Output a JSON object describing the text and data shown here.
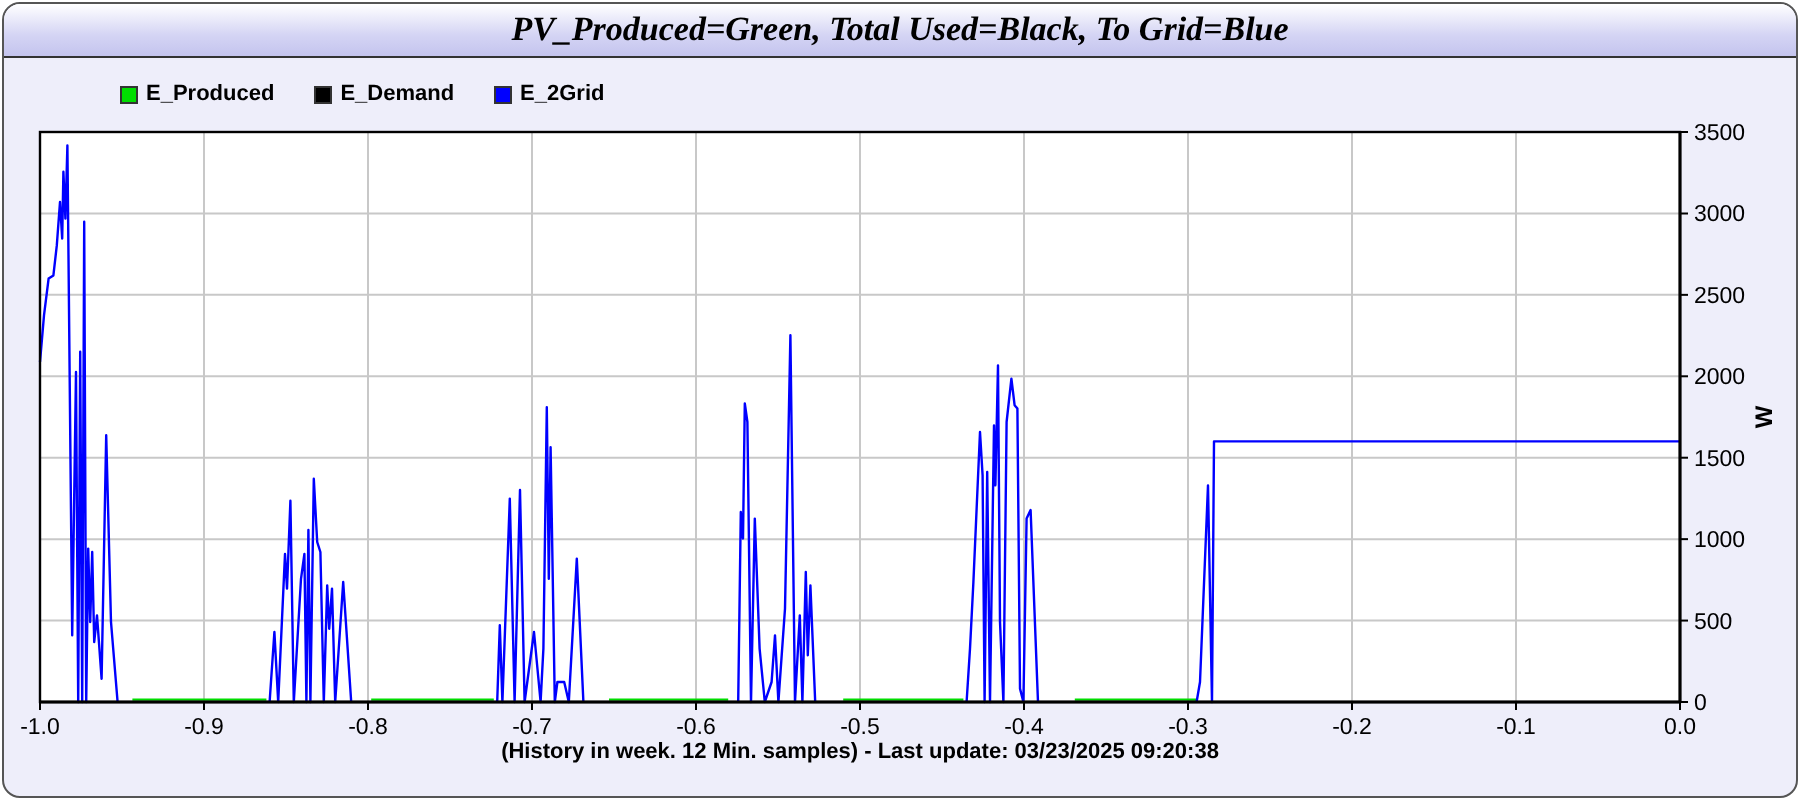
{
  "chart_data": {
    "type": "line",
    "title": "PV_Produced=Green, Total Used=Black, To Grid=Blue",
    "xlabel": "(History in week. 12 Min. samples) - Last update: 03/23/2025 09:20:38",
    "ylabel": "W",
    "grid": true,
    "legend": "top",
    "xlim": [
      -1,
      0
    ],
    "ylim": [
      0,
      3500
    ],
    "xticks": [
      {
        "value": -1,
        "label": "-1.0"
      },
      {
        "value": -0.9,
        "label": "-0.9"
      },
      {
        "value": -0.8,
        "label": "-0.8"
      },
      {
        "value": -0.7,
        "label": "-0.7"
      },
      {
        "value": -0.6,
        "label": "-0.6"
      },
      {
        "value": -0.5,
        "label": "-0.5"
      },
      {
        "value": -0.4,
        "label": "-0.4"
      },
      {
        "value": -0.3,
        "label": "-0.3"
      },
      {
        "value": -0.2,
        "label": "-0.2"
      },
      {
        "value": -0.1,
        "label": "-0.1"
      },
      {
        "value": 0,
        "label": "0.0"
      }
    ],
    "yticks": [
      0,
      500,
      1000,
      1500,
      2000,
      2500,
      3000,
      3500
    ],
    "x": [
      -1.0,
      -0.9976,
      -0.9947,
      -0.9918,
      -0.9898,
      -0.9878,
      -0.9865,
      -0.9857,
      -0.9845,
      -0.9833,
      -0.9804,
      -0.978,
      -0.9767,
      -0.9755,
      -0.9743,
      -0.9731,
      -0.9718,
      -0.9706,
      -0.9694,
      -0.9682,
      -0.9669,
      -0.9653,
      -0.9624,
      -0.9596,
      -0.9567,
      -0.9527,
      -0.9437,
      -0.862,
      -0.86,
      -0.8571,
      -0.8547,
      -0.8506,
      -0.8494,
      -0.8473,
      -0.8453,
      -0.8408,
      -0.8388,
      -0.8376,
      -0.8363,
      -0.8351,
      -0.8331,
      -0.831,
      -0.829,
      -0.827,
      -0.8249,
      -0.8237,
      -0.822,
      -0.82,
      -0.8151,
      -0.8102,
      -0.798,
      -0.7233,
      -0.7212,
      -0.7196,
      -0.718,
      -0.7135,
      -0.7106,
      -0.7073,
      -0.7045,
      -0.6988,
      -0.6947,
      -0.6931,
      -0.691,
      -0.6898,
      -0.6886,
      -0.6861,
      -0.6845,
      -0.6804,
      -0.6776,
      -0.6727,
      -0.6686,
      -0.653,
      -0.5804,
      -0.5743,
      -0.5727,
      -0.5714,
      -0.5702,
      -0.5686,
      -0.5665,
      -0.5641,
      -0.5612,
      -0.558,
      -0.5539,
      -0.5518,
      -0.5498,
      -0.5457,
      -0.5424,
      -0.5396,
      -0.5367,
      -0.5351,
      -0.5331,
      -0.5318,
      -0.5302,
      -0.5273,
      -0.5102,
      -0.437,
      -0.435,
      -0.4329,
      -0.4309,
      -0.4268,
      -0.4252,
      -0.424,
      -0.4224,
      -0.4207,
      -0.4183,
      -0.4175,
      -0.4159,
      -0.4146,
      -0.4126,
      -0.4106,
      -0.4077,
      -0.4057,
      -0.404,
      -0.4024,
      -0.4004,
      -0.3984,
      -0.396,
      -0.3915,
      -0.369,
      -0.295,
      -0.2947,
      -0.2927,
      -0.2878,
      -0.2854,
      -0.2841,
      0.0
    ],
    "series": [
      {
        "name": "E_Produced",
        "color": "#00dd00",
        "values": [
          null,
          null,
          null,
          null,
          null,
          null,
          null,
          null,
          null,
          null,
          null,
          null,
          null,
          null,
          null,
          null,
          null,
          null,
          null,
          null,
          null,
          null,
          null,
          null,
          null,
          null,
          15,
          15,
          null,
          null,
          null,
          null,
          null,
          null,
          null,
          null,
          null,
          null,
          null,
          null,
          null,
          null,
          null,
          null,
          null,
          null,
          null,
          null,
          null,
          null,
          15,
          15,
          null,
          null,
          null,
          null,
          null,
          null,
          null,
          null,
          null,
          null,
          null,
          null,
          null,
          null,
          null,
          null,
          null,
          null,
          null,
          15,
          15,
          null,
          null,
          null,
          null,
          null,
          null,
          null,
          null,
          null,
          null,
          null,
          null,
          null,
          null,
          null,
          null,
          null,
          null,
          null,
          null,
          null,
          15,
          15,
          null,
          null,
          null,
          null,
          null,
          null,
          null,
          null,
          null,
          null,
          null,
          null,
          null,
          null,
          null,
          null,
          null,
          null,
          null,
          null,
          null,
          null,
          15,
          15,
          null,
          null,
          null,
          null,
          null,
          null
        ]
      },
      {
        "name": "E_Demand",
        "color": "#000000",
        "values": [
          null,
          null,
          null,
          null,
          null,
          null,
          null,
          null,
          null,
          null,
          null,
          null,
          null,
          null,
          null,
          null,
          null,
          null,
          null,
          null,
          null,
          null,
          null,
          null,
          null,
          null,
          null,
          null,
          null,
          null,
          null,
          null,
          null,
          null,
          null,
          null,
          null,
          null,
          null,
          null,
          null,
          null,
          null,
          null,
          null,
          null,
          null,
          null,
          null,
          null,
          null,
          null,
          null,
          null,
          null,
          null,
          null,
          null,
          null,
          null,
          null,
          null,
          null,
          null,
          null,
          null,
          null,
          null,
          null,
          null,
          null,
          null,
          null,
          null,
          null,
          null,
          null,
          null,
          null,
          null,
          null,
          null,
          null,
          null,
          null,
          null,
          null,
          null,
          null,
          null,
          null,
          null,
          null,
          null,
          null,
          null,
          null,
          null,
          null,
          null,
          null,
          null,
          null,
          null,
          null,
          null,
          null,
          null,
          null,
          null,
          null,
          null,
          null,
          null,
          null,
          null,
          null,
          null,
          null,
          null,
          null,
          null,
          null,
          null,
          null,
          null
        ]
      },
      {
        "name": "E_2Grid",
        "color": "#0000ff",
        "values": [
          2088,
          2374,
          2600,
          2620,
          2804,
          3070,
          2845,
          3255,
          2968,
          3418,
          410,
          2026,
          0,
          2150,
          0,
          2948,
          0,
          942,
          491,
          921,
          368,
          532,
          143,
          1638,
          491,
          0,
          null,
          null,
          0,
          430,
          0,
          909,
          696,
          1236,
          0,
          757,
          909,
          0,
          1056,
          0,
          1371,
          982,
          921,
          0,
          716,
          450,
          696,
          0,
          737,
          0,
          null,
          null,
          0,
          471,
          0,
          1249,
          0,
          1302,
          0,
          430,
          0,
          328,
          1810,
          757,
          1564,
          0,
          123,
          123,
          0,
          880,
          0,
          null,
          null,
          0,
          1167,
          1003,
          1834,
          1719,
          0,
          1126,
          328,
          0,
          123,
          409,
          0,
          573,
          2252,
          0,
          532,
          0,
          798,
          287,
          716,
          0,
          null,
          null,
          0,
          328,
          737,
          1658,
          1392,
          0,
          1412,
          0,
          1699,
          1330,
          2067,
          491,
          0,
          1719,
          1986,
          1822,
          1801,
          82,
          0,
          1126,
          1179,
          0,
          null,
          null,
          0,
          123,
          1330,
          0,
          1600,
          1600
        ]
      }
    ]
  }
}
